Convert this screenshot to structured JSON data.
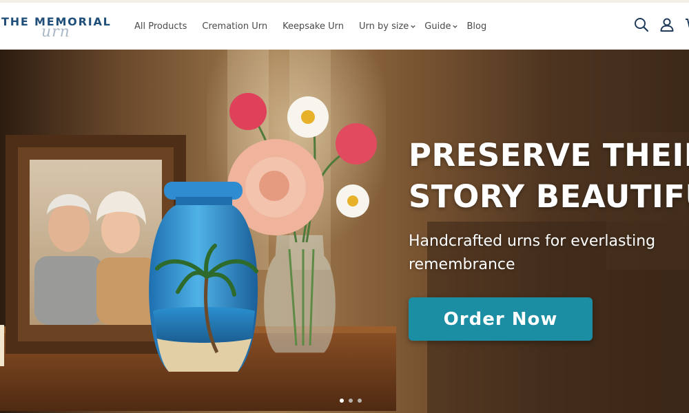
{
  "brand": {
    "name": "THE MEMORIAL",
    "script": "urn"
  },
  "nav": {
    "items": [
      {
        "label": "All Products",
        "dropdown": false
      },
      {
        "label": "Cremation Urn",
        "dropdown": false
      },
      {
        "label": "Keepsake Urn",
        "dropdown": false
      },
      {
        "label": "Urn by size",
        "dropdown": true
      },
      {
        "label": "Guide",
        "dropdown": true
      },
      {
        "label": "Blog",
        "dropdown": false
      }
    ]
  },
  "header_icons": [
    "search-icon",
    "account-icon",
    "cart-icon"
  ],
  "hero": {
    "title_line1": "PRESERVE THEIR",
    "title_line2": "STORY BEAUTIFULLY",
    "subtitle_line1": "Handcrafted urns for everlasting",
    "subtitle_line2": "remembrance",
    "cta_label": "Order Now",
    "slides": 3,
    "active_slide": 1
  },
  "colors": {
    "brand_blue": "#1f4e79",
    "cta_teal": "#1b8ea3",
    "nav_text": "#4a4a4a",
    "hero_text": "#ffffff"
  }
}
